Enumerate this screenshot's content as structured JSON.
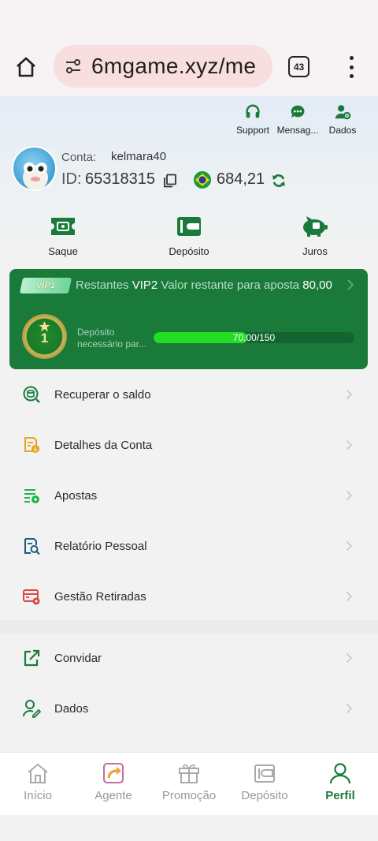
{
  "browser": {
    "url": "6mgame.xyz/me",
    "tab_count": "43"
  },
  "header": {
    "actions": [
      {
        "label": "Support",
        "icon": "headset-icon"
      },
      {
        "label": "Mensag...",
        "icon": "chat-icon"
      },
      {
        "label": "Dados",
        "icon": "user-gear-icon"
      }
    ],
    "account_label": "Conta:",
    "account_value": "kelmara40",
    "id_label": "ID:",
    "id_value": "65318315",
    "balance": "684,21",
    "quick_actions": [
      {
        "label": "Saque",
        "icon": "ticket-icon"
      },
      {
        "label": "Depósito",
        "icon": "wallet-icon"
      },
      {
        "label": "Juros",
        "icon": "piggy-bank-icon"
      }
    ]
  },
  "vip": {
    "badge": "VIP1",
    "remaining_prefix": "Restantes",
    "remaining_level": "VIP2",
    "remaining_text": "Valor restante para aposta",
    "remaining_value": "80,00",
    "level_number": "1",
    "deposit_label": "Depósito necessário par...",
    "progress_text": "70,00/150",
    "progress_fraction": 0.4667,
    "accent_color": "#1a7a3a"
  },
  "menu": {
    "items": [
      {
        "label": "Recuperar o saldo",
        "icon": "coin-refresh-icon"
      },
      {
        "label": "Detalhes da Conta",
        "icon": "account-details-icon"
      },
      {
        "label": "Apostas",
        "icon": "bets-list-icon"
      },
      {
        "label": "Relatório Pessoal",
        "icon": "report-search-icon"
      },
      {
        "label": "Gestão Retiradas",
        "icon": "withdraw-manage-icon"
      },
      {
        "label": "Convidar",
        "icon": "share-icon"
      },
      {
        "label": "Dados",
        "icon": "user-edit-icon"
      }
    ]
  },
  "bottom_nav": {
    "items": [
      {
        "label": "Início",
        "icon": "home-icon"
      },
      {
        "label": "Agente",
        "icon": "agent-share-icon"
      },
      {
        "label": "Promoção",
        "icon": "gift-icon"
      },
      {
        "label": "Depósito",
        "icon": "wallet-icon"
      },
      {
        "label": "Perfil",
        "icon": "profile-icon"
      }
    ],
    "active": "Perfil"
  }
}
